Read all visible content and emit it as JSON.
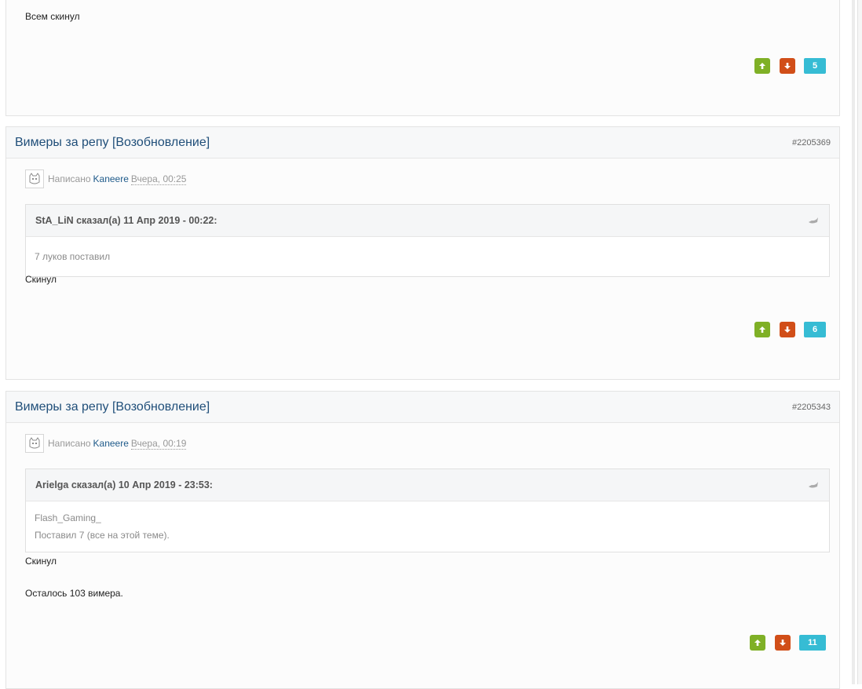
{
  "posts": [
    {
      "body_lines": [
        "Всем скинул"
      ],
      "reputation": "5"
    },
    {
      "title": "Вимеры за репу [Возобновление]",
      "post_id": "#2205369",
      "written_label": "Написано",
      "author": "Kaneere",
      "date": "Вчера, 00:25",
      "quote": {
        "cite": "StA_LiN сказал(а) 11 Апр 2019 - 00:22:",
        "lines": [
          "7 луков поставил"
        ]
      },
      "body_lines": [
        "Скинул"
      ],
      "reputation": "6"
    },
    {
      "title": "Вимеры за репу [Возобновление]",
      "post_id": "#2205343",
      "written_label": "Написано",
      "author": "Kaneere",
      "date": "Вчера, 00:19",
      "quote": {
        "cite": "Arielga сказал(а) 10 Апр 2019 - 23:53:",
        "lines": [
          "Flash_Gaming_",
          "Поставил 7 (все на этой теме)."
        ]
      },
      "body_lines": [
        "Скинул",
        "Осталось 103 вимера."
      ],
      "reputation": "11"
    }
  ],
  "icons": {
    "vote_up": "arrow-up-icon",
    "vote_down": "arrow-down-icon",
    "quote_link": "quote-link-icon",
    "avatar": "avatar-icon"
  },
  "colors": {
    "title": "#1f4e79",
    "vote_up": "#7fb026",
    "vote_down": "#d14e18",
    "reputation": "#36bcd4"
  }
}
